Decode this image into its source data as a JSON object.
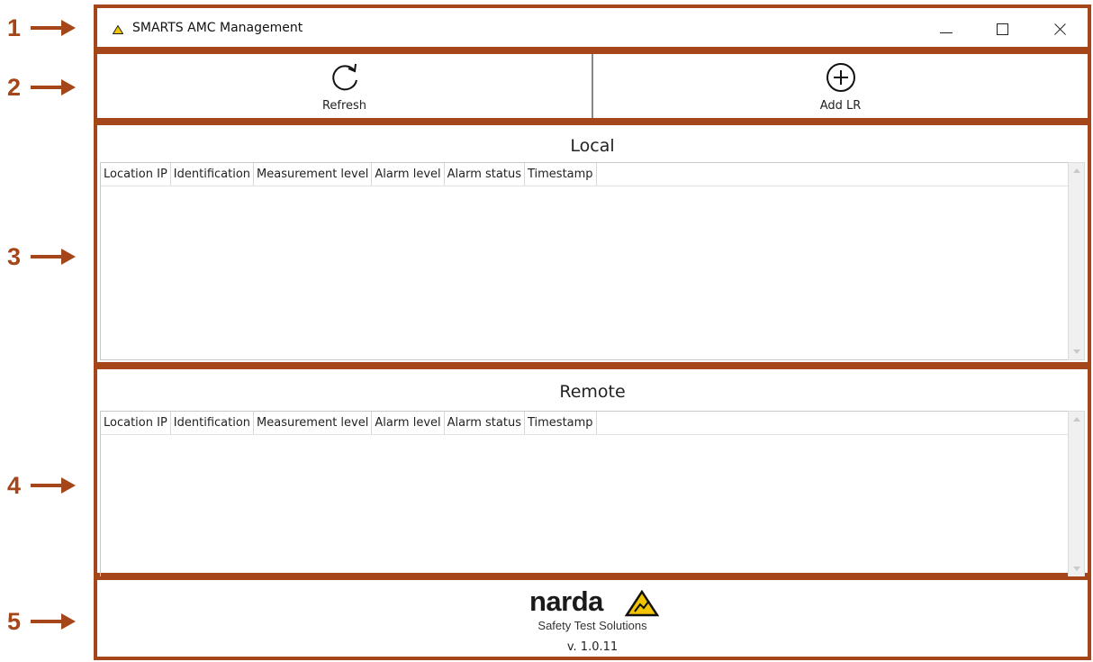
{
  "callouts": [
    "1",
    "2",
    "3",
    "4",
    "5"
  ],
  "window": {
    "title": "SMARTS AMC Management",
    "accent": "#a5461a"
  },
  "toolbar": {
    "refresh_label": "Refresh",
    "add_lr_label": "Add LR"
  },
  "local": {
    "title": "Local",
    "columns": [
      "Location IP",
      "Identification",
      "Measurement level",
      "Alarm level",
      "Alarm status",
      "Timestamp"
    ],
    "rows": []
  },
  "remote": {
    "title": "Remote",
    "columns": [
      "Location IP",
      "Identification",
      "Measurement level",
      "Alarm level",
      "Alarm status",
      "Timestamp"
    ],
    "rows": []
  },
  "footer": {
    "brand": "narda",
    "tagline": "Safety Test Solutions",
    "version": "v. 1.0.11"
  }
}
